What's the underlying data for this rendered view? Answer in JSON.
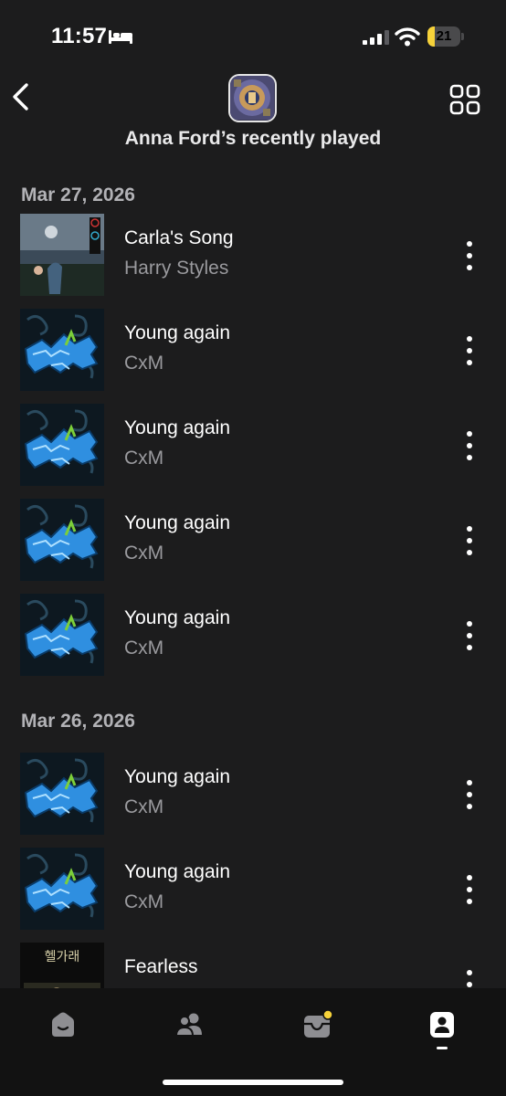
{
  "status_bar": {
    "time": "11:57",
    "battery_percent": "21",
    "battery_level": 0.21,
    "icons": [
      "bed-icon",
      "signal-icon",
      "wifi-icon",
      "battery-icon"
    ]
  },
  "header": {
    "title": "Anna Ford’s recently played",
    "icons": [
      "chevron-left-icon",
      "grid-icon"
    ]
  },
  "sections": [
    {
      "date": "Mar 27, 2026",
      "tracks": [
        {
          "title": "Carla's Song",
          "artist": "Harry Styles",
          "art": "carla"
        },
        {
          "title": "Young again",
          "artist": "CxM",
          "art": "graffiti"
        },
        {
          "title": "Young again",
          "artist": "CxM",
          "art": "graffiti"
        },
        {
          "title": "Young again",
          "artist": "CxM",
          "art": "graffiti"
        },
        {
          "title": "Young again",
          "artist": "CxM",
          "art": "graffiti"
        }
      ]
    },
    {
      "date": "Mar 26, 2026",
      "tracks": [
        {
          "title": "Young again",
          "artist": "CxM",
          "art": "graffiti"
        },
        {
          "title": "Young again",
          "artist": "CxM",
          "art": "graffiti"
        },
        {
          "title": "Fearless",
          "artist": "",
          "art": "fearless"
        }
      ]
    }
  ],
  "tab_bar": {
    "tabs": [
      "home-icon",
      "friends-icon",
      "inbox-icon",
      "profile-icon"
    ],
    "active_tab": "profile-icon",
    "inbox_badge_color": "#f6d23a"
  },
  "colors": {
    "background": "#1c1c1d",
    "accent": "#f6d23a",
    "graffiti_blue": "#2f8fe0"
  }
}
